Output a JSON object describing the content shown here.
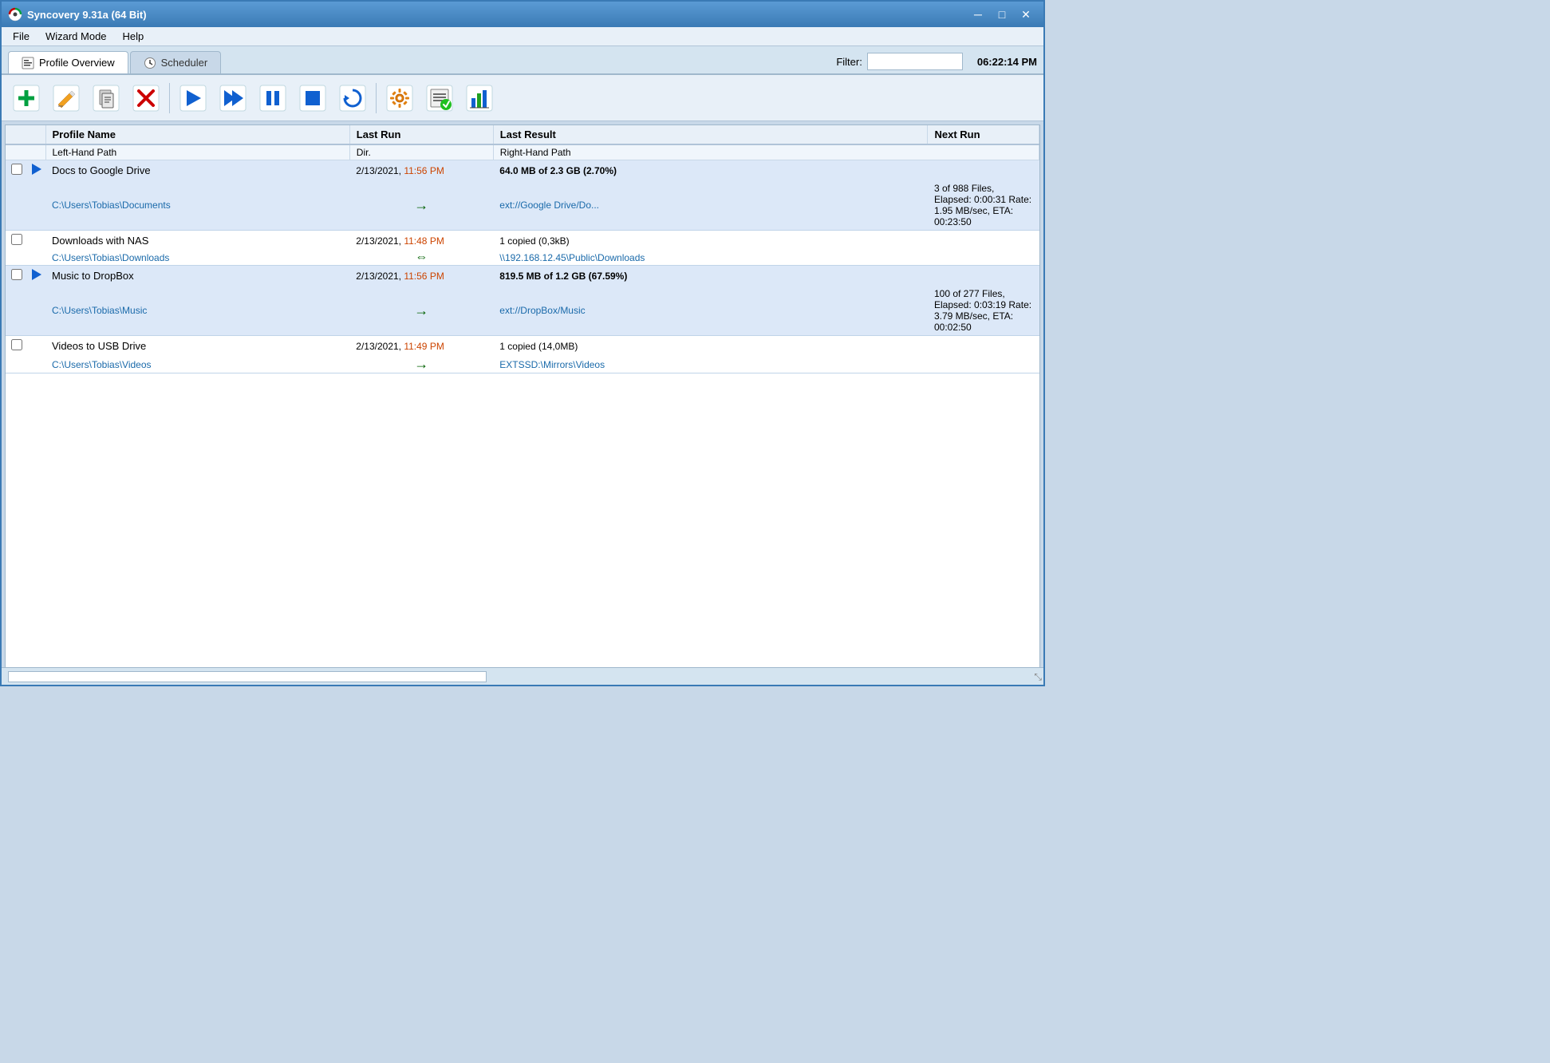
{
  "titleBar": {
    "icon": "syncovery-icon",
    "title": "Syncovery 9.31a (64 Bit)",
    "minimize": "─",
    "restore": "□",
    "close": "✕"
  },
  "menuBar": {
    "items": [
      "File",
      "Wizard Mode",
      "Help"
    ]
  },
  "tabs": [
    {
      "id": "profile-overview",
      "label": "Profile Overview",
      "active": true
    },
    {
      "id": "scheduler",
      "label": "Scheduler",
      "active": false
    }
  ],
  "filter": {
    "label": "Filter:",
    "placeholder": "",
    "value": ""
  },
  "time": "06:22:14 PM",
  "toolbar": {
    "buttons": [
      {
        "id": "add",
        "title": "Add new profile",
        "symbol": "+"
      },
      {
        "id": "edit",
        "title": "Edit profile",
        "symbol": "✏"
      },
      {
        "id": "copy",
        "title": "Copy profile",
        "symbol": "⊟"
      },
      {
        "id": "delete",
        "title": "Delete profile",
        "symbol": "✕"
      },
      {
        "id": "run",
        "title": "Run selected profile",
        "symbol": "▶"
      },
      {
        "id": "run-all",
        "title": "Run all profiles",
        "symbol": "▶▶"
      },
      {
        "id": "pause",
        "title": "Pause",
        "symbol": "⏸"
      },
      {
        "id": "stop",
        "title": "Stop",
        "symbol": "⏹"
      },
      {
        "id": "refresh",
        "title": "Refresh",
        "symbol": "↻"
      },
      {
        "id": "settings",
        "title": "Settings",
        "symbol": "⚙"
      },
      {
        "id": "log",
        "title": "View log",
        "symbol": "📋"
      },
      {
        "id": "summary",
        "title": "Summary",
        "symbol": "📊"
      }
    ]
  },
  "table": {
    "headers": {
      "profileName": "Profile Name",
      "leftHandPath": "Left-Hand Path",
      "dir": "Dir.",
      "lastRun": "Last Run",
      "rightHandPath": "Right-Hand Path",
      "lastResult": "Last Result",
      "nextRun": "Next Run"
    },
    "profiles": [
      {
        "id": "docs-google",
        "name": "Docs to Google Drive",
        "leftPath": "C:\\Users\\Tobias\\Documents",
        "dir": "→",
        "dirColor": "#006000",
        "lastRunDate": "2/13/2021,",
        "lastRunTime": "11:56 PM",
        "rightPath": "ext://Google Drive/Do...",
        "lastResultBold": "64.0 MB of 2.3 GB (2.70%)",
        "lastResultNormal": "3 of 988 Files, Elapsed: 0:00:31  Rate: 1.95 MB/sec, ETA: 00:23:50",
        "nextRun": "",
        "hasPlayBtn": true,
        "highlighted": true
      },
      {
        "id": "downloads-nas",
        "name": "Downloads with NAS",
        "leftPath": "C:\\Users\\Tobias\\Downloads",
        "dir": "⇔",
        "dirColor": "#006000",
        "lastRunDate": "2/13/2021,",
        "lastRunTime": "11:48 PM",
        "rightPath": "\\\\192.168.12.45\\Public\\Downloads",
        "lastResultBold": "",
        "lastResultNormal": "1 copied (0,3kB)",
        "nextRun": "",
        "hasPlayBtn": false,
        "highlighted": false
      },
      {
        "id": "music-dropbox",
        "name": "Music to DropBox",
        "leftPath": "C:\\Users\\Tobias\\Music",
        "dir": "→",
        "dirColor": "#006000",
        "lastRunDate": "2/13/2021,",
        "lastRunTime": "11:56 PM",
        "rightPath": "ext://DropBox/Music",
        "lastResultBold": "819.5 MB of 1.2 GB (67.59%)",
        "lastResultNormal": "100 of 277 Files, Elapsed: 0:03:19  Rate: 3.79 MB/sec, ETA: 00:02:50",
        "nextRun": "",
        "hasPlayBtn": true,
        "highlighted": true
      },
      {
        "id": "videos-usb",
        "name": "Videos to USB Drive",
        "leftPath": "C:\\Users\\Tobias\\Videos",
        "dir": "→",
        "dirColor": "#006000",
        "lastRunDate": "2/13/2021,",
        "lastRunTime": "11:49 PM",
        "rightPath": "EXTSSD:\\Mirrors\\Videos",
        "lastResultBold": "",
        "lastResultNormal": "1 copied (14,0MB)",
        "nextRun": "",
        "hasPlayBtn": false,
        "highlighted": false
      }
    ]
  }
}
